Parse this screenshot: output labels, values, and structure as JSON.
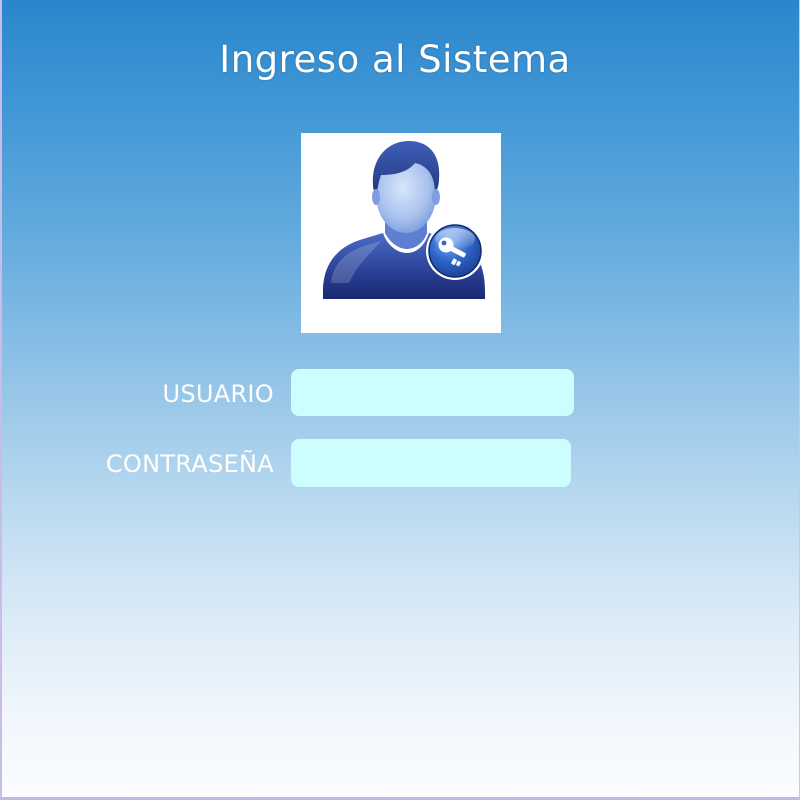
{
  "login": {
    "title": "Ingreso al Sistema",
    "username_label": "USUARIO",
    "username_value": "",
    "password_label": "CONTRASEÑA",
    "password_value": ""
  },
  "colors": {
    "background_top": "#2a86cc",
    "background_bottom": "#fbfdff",
    "input_fill": "#ccfdff",
    "label_text": "#ffffff"
  },
  "icons": {
    "avatar": "user-key-icon"
  }
}
